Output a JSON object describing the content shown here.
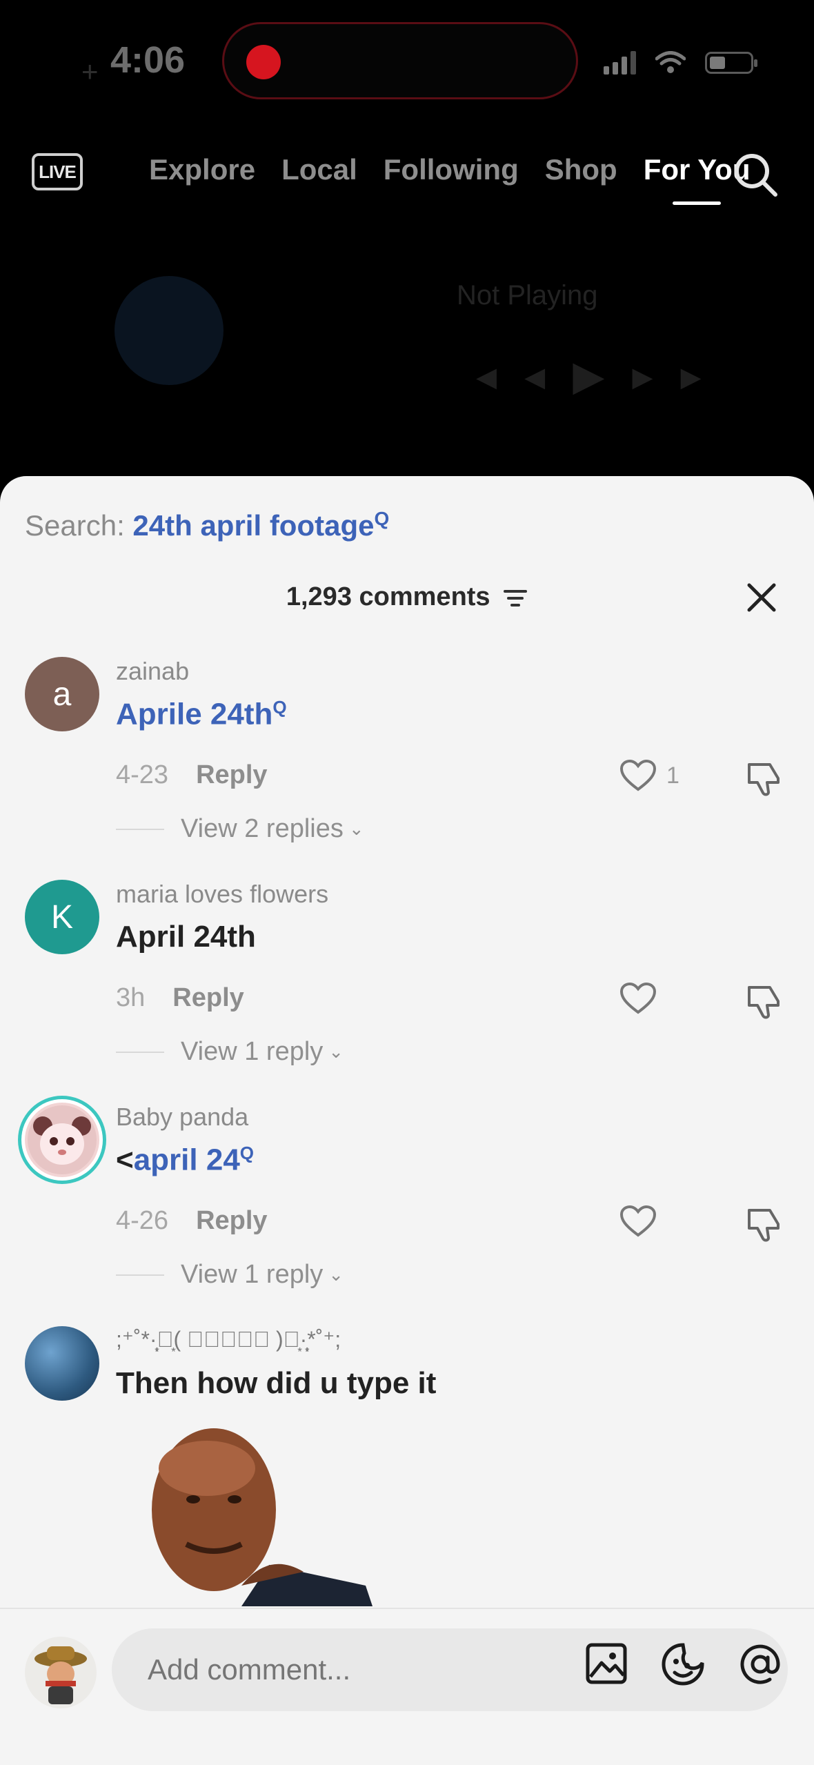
{
  "status": {
    "time": "4:06"
  },
  "top_nav": {
    "live_label": "LIVE",
    "tabs": [
      {
        "label": "Explore",
        "active": false
      },
      {
        "label": "Local",
        "active": false
      },
      {
        "label": "Following",
        "active": false
      },
      {
        "label": "Shop",
        "active": false
      },
      {
        "label": "For You",
        "active": true
      }
    ]
  },
  "background": {
    "not_playing": "Not Playing"
  },
  "comments_sheet": {
    "search_prefix": "Search: ",
    "search_term": "24th april footage",
    "count_label": "1,293 comments",
    "comments": [
      {
        "username": "zainab",
        "avatar_letter": "a",
        "avatar_color": "#7d5f55",
        "text": "Aprile 24th",
        "text_is_search_link": true,
        "date": "4-23",
        "reply_label": "Reply",
        "like_count": "1",
        "view_replies": "View 2 replies"
      },
      {
        "username": "maria loves flowers",
        "avatar_letter": "K",
        "avatar_color": "#1f9a90",
        "text": "April 24th",
        "text_is_search_link": false,
        "date": "3h",
        "reply_label": "Reply",
        "like_count": "",
        "view_replies": "View 1 reply"
      },
      {
        "username": "Baby panda",
        "avatar_letter": "",
        "avatar_color": "#f2d4d4",
        "text_prefix": "<",
        "text": "april 24",
        "text_is_search_link": true,
        "date": "4-26",
        "reply_label": "Reply",
        "like_count": "",
        "view_replies": "View 1 reply"
      },
      {
        "username": ";⁺˚*·̩͙‧͙( 𝒏𝒊𝒚𝒂𝒉 )‧͙·̩͙*˚⁺;",
        "avatar_letter": "",
        "avatar_color": "#2e5a80",
        "text": "Then how did u type it",
        "text_is_search_link": false
      }
    ],
    "input_placeholder": "Add comment..."
  },
  "colors": {
    "link": "#3d63b8",
    "recording": "#d6151f",
    "sheet_bg": "#f4f4f4"
  }
}
